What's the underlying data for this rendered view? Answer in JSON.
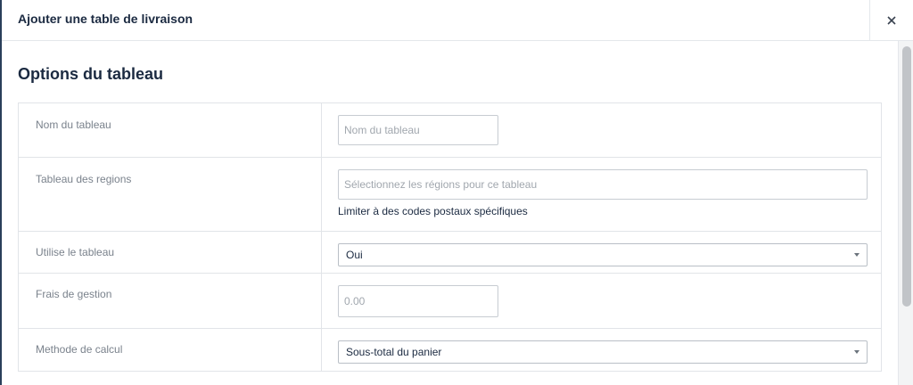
{
  "modal": {
    "title": "Ajouter une table de livraison",
    "close_label": "×"
  },
  "section": {
    "title": "Options du tableau"
  },
  "fields": {
    "table_name": {
      "label": "Nom du tableau",
      "placeholder": "Nom du tableau"
    },
    "regions": {
      "label": "Tableau des regions",
      "placeholder": "Sélectionnez les régions pour ce tableau",
      "link": "Limiter à des codes postaux spécifiques"
    },
    "use_table": {
      "label": "Utilise le tableau",
      "value": "Oui"
    },
    "handling_fee": {
      "label": "Frais de gestion",
      "placeholder": "0.00"
    },
    "calc_method": {
      "label": "Methode de calcul",
      "value": "Sous-total du panier"
    }
  },
  "icons": {
    "close": "close-icon",
    "dropdown": "chevron-down-icon"
  }
}
